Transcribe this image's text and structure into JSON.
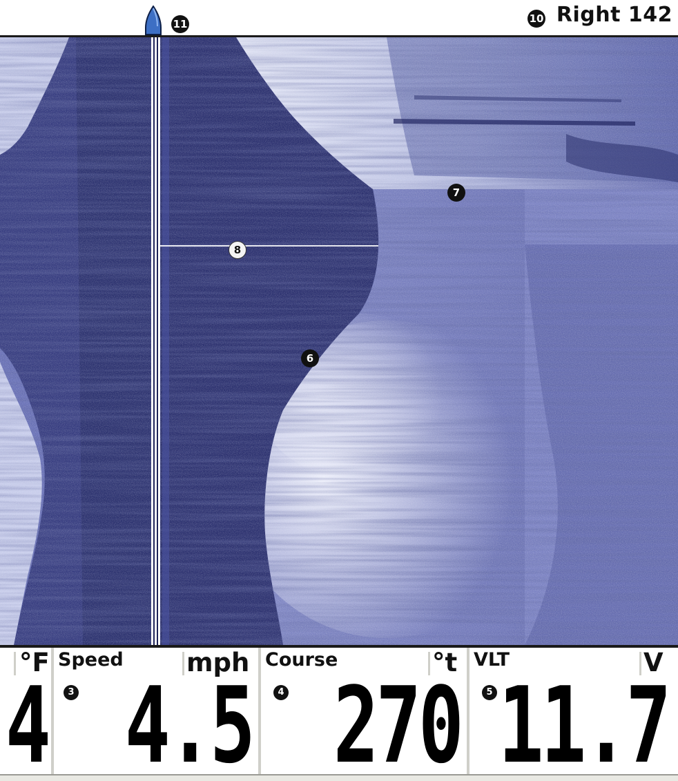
{
  "top_bar": {
    "boat_callout": "11",
    "range_callout": "10",
    "range_label": "Right 142"
  },
  "sonar_view": {
    "callouts": {
      "bottom_edge_callout": "6",
      "structure_callout": "7",
      "depth_line_callout": "8"
    }
  },
  "data_bar": {
    "temp": {
      "unit": "°F",
      "value": "4"
    },
    "speed": {
      "label": "Speed",
      "unit": "mph",
      "callout": "3",
      "value": "4.5"
    },
    "course": {
      "label": "Course",
      "unit": "°t",
      "callout": "4",
      "value": "270"
    },
    "voltage": {
      "label": "VLT",
      "unit": "V",
      "callout": "5",
      "value": "11.7"
    }
  },
  "colors": {
    "sonar_dark": "#2f3472",
    "sonar_mid": "#5b62a6",
    "sonar_light": "#d8dcf0",
    "text": "#111111",
    "separator": "#cfcfc9"
  }
}
